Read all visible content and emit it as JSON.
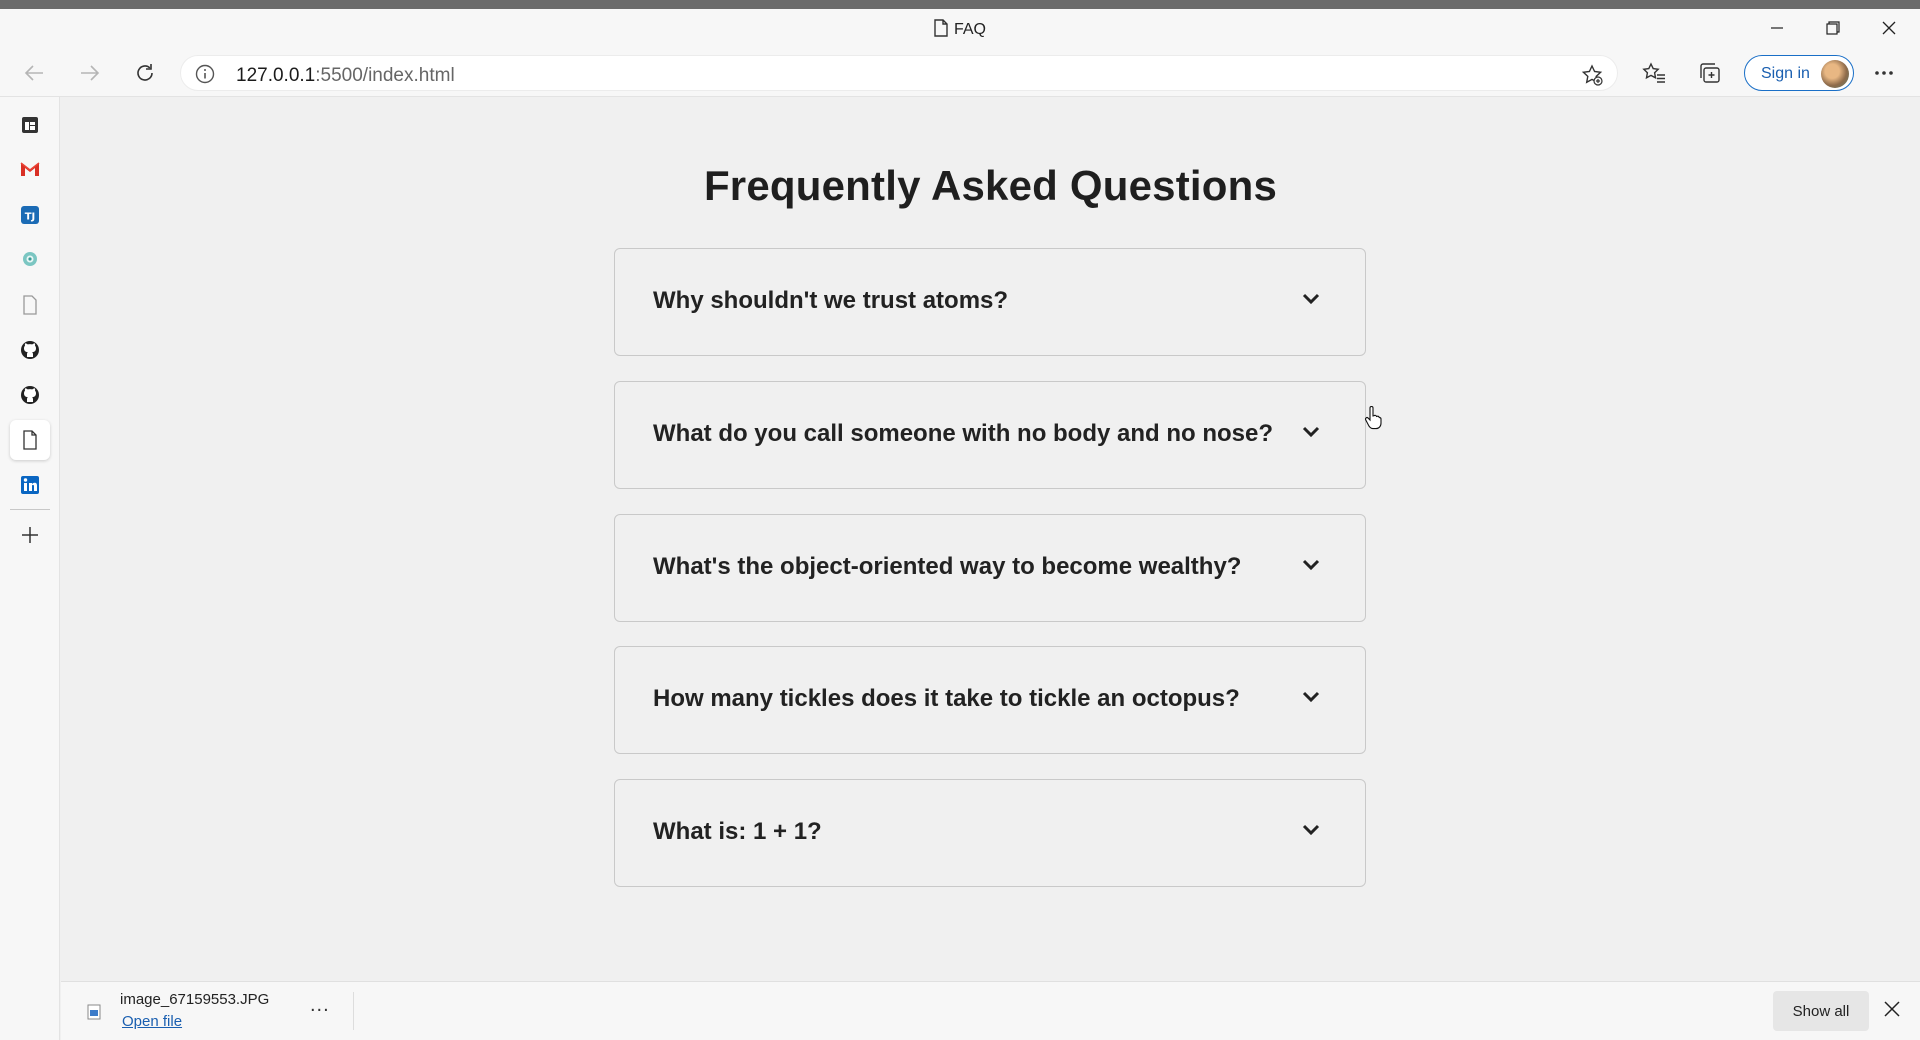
{
  "window": {
    "title": "FAQ",
    "minimize_icon": "minimize-icon",
    "restore_icon": "restore-icon",
    "close_icon": "close-icon"
  },
  "toolbar": {
    "url_host": "127.0.0.1",
    "url_rest": ":5500/index.html",
    "sign_in": "Sign in"
  },
  "sidebar": {
    "items": [
      "office-icon",
      "gmail-icon",
      "tj-icon",
      "location-icon",
      "page-icon",
      "github-icon",
      "github-icon",
      "page-icon",
      "linkedin-icon"
    ],
    "add_icon": "add-icon"
  },
  "faq": {
    "title": "Frequently Asked Questions",
    "items": [
      {
        "question": "Why shouldn't we trust atoms?"
      },
      {
        "question": "What do you call someone with no body and no nose?"
      },
      {
        "question": "What's the object-oriented way to become wealthy?"
      },
      {
        "question": "How many tickles does it take to tickle an octopus?"
      },
      {
        "question": "What is: 1 + 1?"
      }
    ]
  },
  "downloads": {
    "file_name": "image_67159553.JPG",
    "open_label": "Open file",
    "more": "...",
    "show_all": "Show all"
  },
  "colors": {
    "accent": "#1a5fb0",
    "page_bg": "#f0f0f0",
    "border": "#c9c9c9"
  }
}
